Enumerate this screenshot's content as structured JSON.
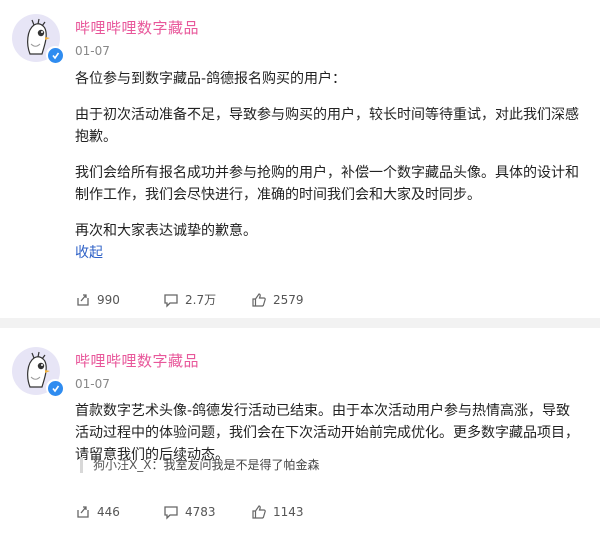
{
  "posts": [
    {
      "username": "哔哩哔哩数字藏品",
      "date": "01-07",
      "paragraphs": [
        "各位参与到数字藏品-鸽德报名购买的用户：",
        "由于初次活动准备不足，导致参与购买的用户，较长时间等待重试，对此我们深感抱歉。",
        "我们会给所有报名成功并参与抢购的用户，补偿一个数字藏品头像。具体的设计和制作工作，我们会尽快进行，准确的时间我们会和大家及时同步。",
        "再次和大家表达诚挚的歉意。"
      ],
      "collapse_label": "收起",
      "repost_count": "990",
      "comment_count": "2.7万",
      "like_count": "2579"
    },
    {
      "username": "哔哩哔哩数字藏品",
      "date": "01-07",
      "paragraphs": [
        "首款数字艺术头像-鸽德发行活动已结束。由于本次活动用户参与热情高涨，导致活动过程中的体验问题，我们会在下次活动开始前完成优化。更多数字藏品项目，请留意我们的后续动态。"
      ],
      "quote_author": "狗小汪X_X",
      "quote_text": "：我室友问我是不是得了帕金森",
      "repost_count": "446",
      "comment_count": "4783",
      "like_count": "1143"
    }
  ],
  "icons": {
    "repost": "repost-icon",
    "comment": "comment-icon",
    "like": "thumbs-up-icon",
    "verified": "verified-badge-icon"
  },
  "colors": {
    "username": "#e8579a",
    "link": "#2f62c7",
    "verified": "#2f8cf0",
    "divider": "#f2f2f2"
  }
}
